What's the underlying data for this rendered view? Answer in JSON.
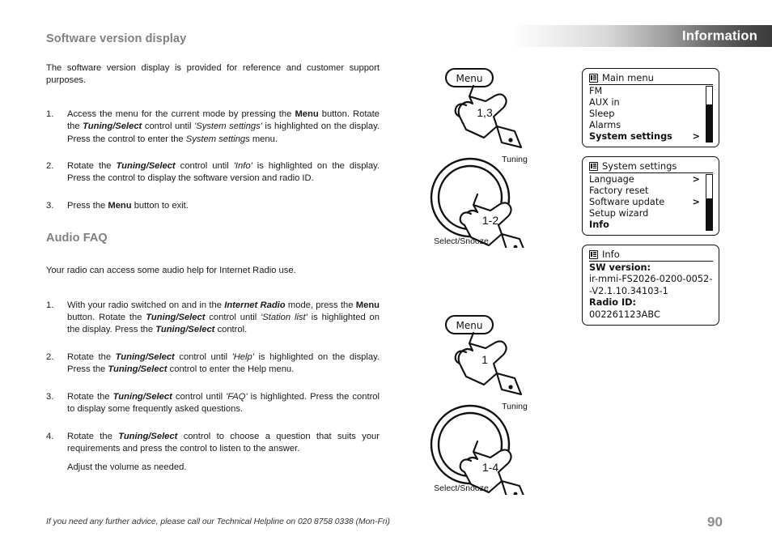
{
  "header": {
    "title": "Information"
  },
  "left_column": {
    "section1_heading": "Software version display",
    "section1_intro": "The software version display is provided for reference and customer support purposes.",
    "section1_steps": [
      {
        "num": "1.",
        "html": "Access the menu for the current mode by pressing the <b>Menu</b> button. Rotate the <span class=\"bi\">Tuning/Select</span> control until <i>'System settings'</i> is highlighted on the display. Press the control to enter the <i>System settings</i> menu."
      },
      {
        "num": "2.",
        "html": "Rotate the <span class=\"bi\">Tuning/Select</span> control until <i>'Info'</i> is highlighted on the display. Press the control to display the software version and radio ID."
      },
      {
        "num": "3.",
        "html": "Press the <b>Menu</b> button to exit."
      }
    ],
    "section2_heading": "Audio FAQ",
    "section2_intro": "Your radio can access some audio help for Internet Radio use.",
    "section2_steps": [
      {
        "num": "1.",
        "html": "With your radio switched on and in the <span class=\"bi\">Internet Radio</span> mode, press the <b>Menu</b> button. Rotate the <span class=\"bi\">Tuning/Select</span> control until <i>'Station list'</i> is highlighted on the display. Press the <span class=\"bi\">Tuning/Select</span> control."
      },
      {
        "num": "2.",
        "html": "Rotate the <span class=\"bi\">Tuning/Select</span> control until <i>'Help'</i> is highlighted on the display. Press the <span class=\"bi\">Tuning/Select</span> control to enter the Help menu."
      },
      {
        "num": "3.",
        "html": "Rotate the <span class=\"bi\">Tuning/Select</span> control until <i>'FAQ'</i> is highlighted. Press the control to display some frequently asked questions."
      },
      {
        "num": "4.",
        "html": "Rotate the <span class=\"bi\">Tuning/Select</span> control to choose a question that suits your requirements and press the control to listen to the answer."
      }
    ],
    "section2_step4_sub": "Adjust the volume as needed."
  },
  "illustrations": {
    "menu_button_label": "Menu",
    "tuning_label": "Tuning",
    "select_snooze_label": "Select/Snooze",
    "step_ref_menu_1": "1,3",
    "step_ref_dial_1": "1-2",
    "step_ref_menu_2": "1",
    "step_ref_dial_2": "1-4"
  },
  "lcd_main_menu": {
    "title": "Main menu",
    "rows": [
      {
        "label": "FM",
        "arrow": "",
        "selected": false
      },
      {
        "label": "AUX in",
        "arrow": "",
        "selected": false
      },
      {
        "label": "Sleep",
        "arrow": "",
        "selected": false
      },
      {
        "label": "Alarms",
        "arrow": "",
        "selected": false
      },
      {
        "label": "System settings",
        "arrow": ">",
        "selected": true
      }
    ]
  },
  "lcd_system_settings": {
    "title": "System settings",
    "rows": [
      {
        "label": "Language",
        "arrow": ">",
        "selected": false
      },
      {
        "label": "Factory reset",
        "arrow": "",
        "selected": false
      },
      {
        "label": "Software update",
        "arrow": ">",
        "selected": false
      },
      {
        "label": "Setup wizard",
        "arrow": "",
        "selected": false
      },
      {
        "label": "Info",
        "arrow": "",
        "selected": true
      }
    ]
  },
  "lcd_info": {
    "title": "Info",
    "sw_version_label": "SW version:",
    "sw_version_line1": "ir-mmi-FS2026-0200-0052-",
    "sw_version_line2": "-V2.1.10.34103-1",
    "radio_id_label": "Radio ID:",
    "radio_id_value": "002261123ABC"
  },
  "footer": {
    "helpline": "If you need any further advice, please call our Technical Helpline on 020 8758 0338 (Mon-Fri)",
    "page_number": "90"
  },
  "colors": {
    "heading_gray": "#808080",
    "page_number_gray": "#8c8c8c",
    "banner_dark": "#3a3a3a",
    "lcd_black": "#111111"
  }
}
